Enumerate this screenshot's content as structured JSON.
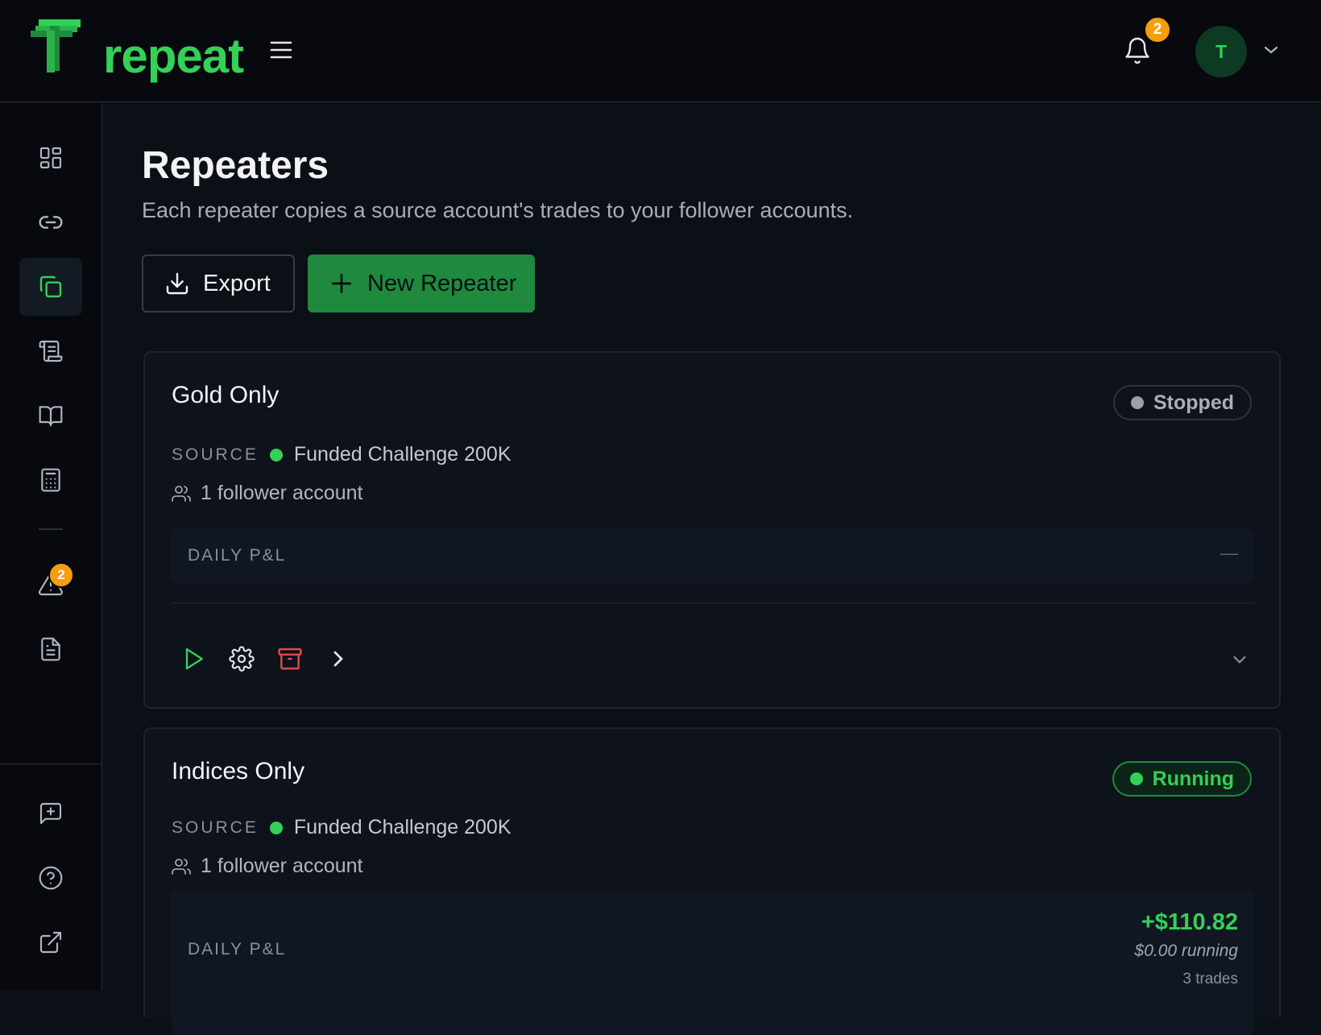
{
  "app": {
    "logo_text": "repeat",
    "colors": {
      "accent": "#34d058",
      "accent_dark": "#1f8a3e",
      "badge": "#f59e0b",
      "danger": "#e5484d",
      "background": "#0b0f16"
    }
  },
  "header": {
    "menu_icon": "hamburger-menu-icon",
    "notifications": {
      "icon": "bell-icon",
      "count": "2"
    },
    "user": {
      "avatar_initial": "T",
      "chevron_icon": "chevron-down-icon"
    }
  },
  "sidebar": {
    "items": [
      {
        "name": "dashboard",
        "icon": "grid-icon",
        "active": false
      },
      {
        "name": "connections",
        "icon": "link-icon",
        "active": false
      },
      {
        "name": "repeaters",
        "icon": "copy-icon",
        "active": true
      },
      {
        "name": "scripts",
        "icon": "scroll-icon",
        "active": false
      },
      {
        "name": "journal",
        "icon": "book-icon",
        "active": false
      },
      {
        "name": "calculator",
        "icon": "calculator-icon",
        "active": false
      },
      {
        "name": "alerts",
        "icon": "warning-icon",
        "active": false,
        "badge": "2"
      },
      {
        "name": "reports",
        "icon": "document-icon",
        "active": false
      }
    ],
    "bottom_items": [
      {
        "name": "feedback",
        "icon": "message-plus-icon"
      },
      {
        "name": "help",
        "icon": "help-circle-icon"
      },
      {
        "name": "external",
        "icon": "external-link-icon"
      }
    ]
  },
  "page": {
    "title": "Repeaters",
    "subtitle": "Each repeater copies a source account's trades to your follower accounts.",
    "export_label": "Export",
    "new_label": "New Repeater"
  },
  "repeaters": [
    {
      "name": "Gold Only",
      "status": "Stopped",
      "source_label": "SOURCE",
      "source_account": "Funded Challenge 200K",
      "followers": "1 follower account",
      "pnl_label": "DAILY P&L",
      "pnl_value": "—"
    },
    {
      "name": "Indices Only",
      "status": "Running",
      "source_label": "SOURCE",
      "source_account": "Funded Challenge 200K",
      "followers": "1 follower account",
      "pnl_label": "DAILY P&L",
      "pnl_value": "+$110.82",
      "pnl_running": "$0.00 running",
      "pnl_trades": "3 trades"
    }
  ]
}
